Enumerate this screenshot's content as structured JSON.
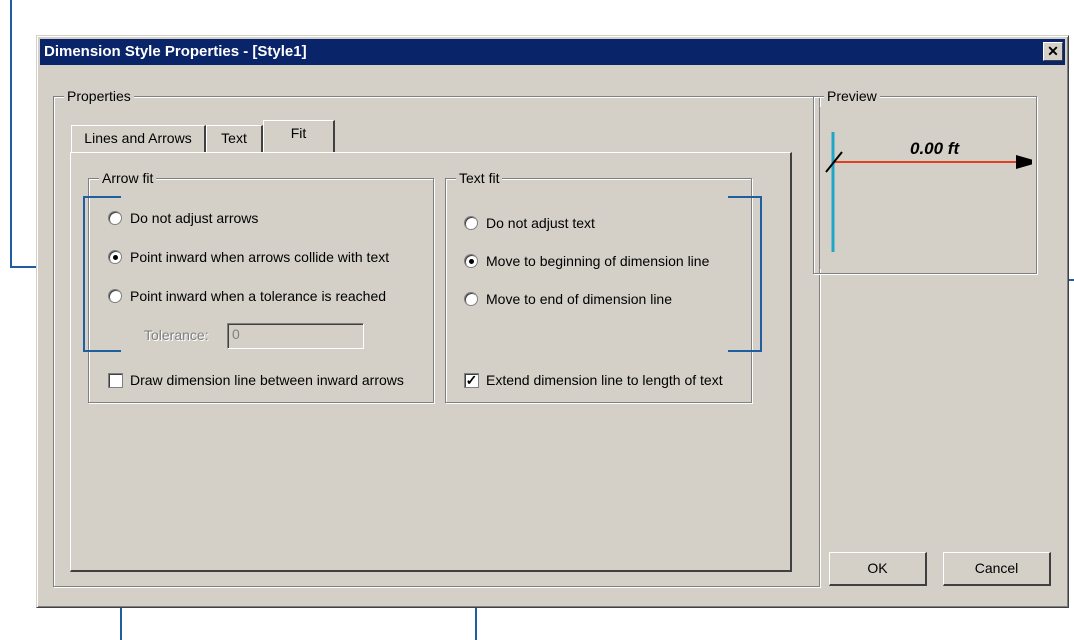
{
  "dialog": {
    "title": "Dimension Style Properties - [Style1]",
    "close_glyph": "✕"
  },
  "properties": {
    "group_label": "Properties",
    "tabs": [
      {
        "label": "Lines and Arrows",
        "active": false
      },
      {
        "label": "Text",
        "active": false
      },
      {
        "label": "Fit",
        "active": true
      }
    ]
  },
  "arrow_fit": {
    "group_label": "Arrow fit",
    "options": [
      {
        "label": "Do not adjust arrows",
        "selected": false
      },
      {
        "label": "Point inward when arrows collide with text",
        "selected": true
      },
      {
        "label": "Point inward when a tolerance is reached",
        "selected": false
      }
    ],
    "tolerance_label": "Tolerance:",
    "tolerance_value": "0",
    "draw_line_label": "Draw dimension line between inward arrows",
    "draw_line_checked": false
  },
  "text_fit": {
    "group_label": "Text fit",
    "options": [
      {
        "label": "Do not adjust text",
        "selected": false
      },
      {
        "label": "Move to beginning of dimension line",
        "selected": true
      },
      {
        "label": "Move to end of dimension line",
        "selected": false
      }
    ],
    "extend_label": "Extend dimension line to length of text",
    "extend_checked": true,
    "check_glyph": "✓"
  },
  "preview": {
    "group_label": "Preview",
    "dimension_text": "0.00 ft",
    "extension_line_color": "#1ea7c8",
    "dimension_line_color": "#e0401e"
  },
  "buttons": {
    "ok": "OK",
    "cancel": "Cancel"
  },
  "colors": {
    "title_bar": "#0a246a",
    "dialog_face": "#d4d0c8",
    "callout_line": "#1f5fa0"
  }
}
